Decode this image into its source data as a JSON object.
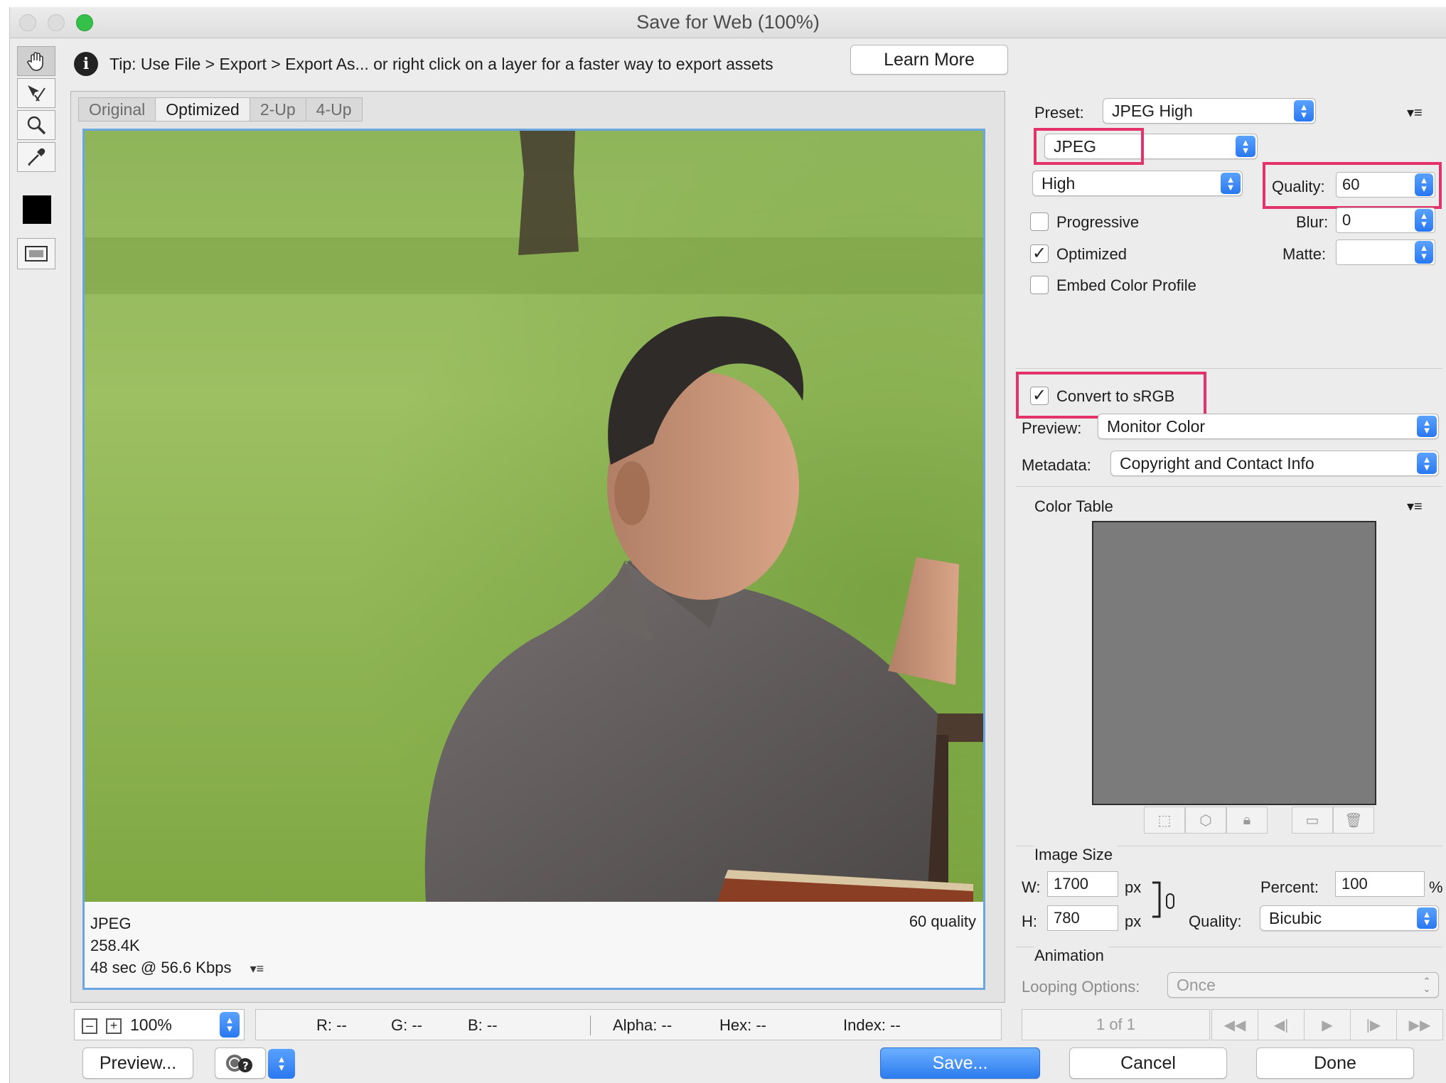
{
  "window": {
    "title": "Save for Web (100%)"
  },
  "tip": {
    "text": "Tip: Use File > Export > Export As...  or right click on a layer for a faster way to export assets",
    "learn_more": "Learn More"
  },
  "tabs": [
    "Original",
    "Optimized",
    "2-Up",
    "4-Up"
  ],
  "active_tab": "Optimized",
  "image_info": {
    "format": "JPEG",
    "size": "258.4K",
    "download_time": "48 sec @ 56.6 Kbps",
    "quality_note": "60 quality"
  },
  "status": {
    "zoom": "100%",
    "r": "R: --",
    "g": "G: --",
    "b": "B: --",
    "alpha": "Alpha: --",
    "hex": "Hex: --",
    "index": "Index: --"
  },
  "buttons": {
    "preview": "Preview...",
    "save": "Save...",
    "cancel": "Cancel",
    "done": "Done"
  },
  "settings": {
    "preset_label": "Preset:",
    "preset": "JPEG High",
    "format": "JPEG",
    "compression": "High",
    "quality_label": "Quality:",
    "quality": "60",
    "blur_label": "Blur:",
    "blur": "0",
    "matte_label": "Matte:",
    "matte": "",
    "progressive": "Progressive",
    "optimized": "Optimized",
    "embed_profile": "Embed Color Profile",
    "convert_srgb": "Convert to sRGB",
    "preview_label": "Preview:",
    "preview_value": "Monitor Color",
    "metadata_label": "Metadata:",
    "metadata_value": "Copyright and Contact Info"
  },
  "color_table": {
    "title": "Color Table"
  },
  "image_size": {
    "title": "Image Size",
    "w_label": "W:",
    "w": "1700",
    "h_label": "H:",
    "h": "780",
    "unit": "px",
    "percent_label": "Percent:",
    "percent": "100",
    "percent_unit": "%",
    "quality_label": "Quality:",
    "quality": "Bicubic"
  },
  "animation": {
    "title": "Animation",
    "looping_label": "Looping Options:",
    "looping": "Once",
    "frames": "1 of 1"
  },
  "colors": {
    "highlight": "#e4336b",
    "accent": "#2d7cf0",
    "panel_border": "#6aa7e0"
  }
}
